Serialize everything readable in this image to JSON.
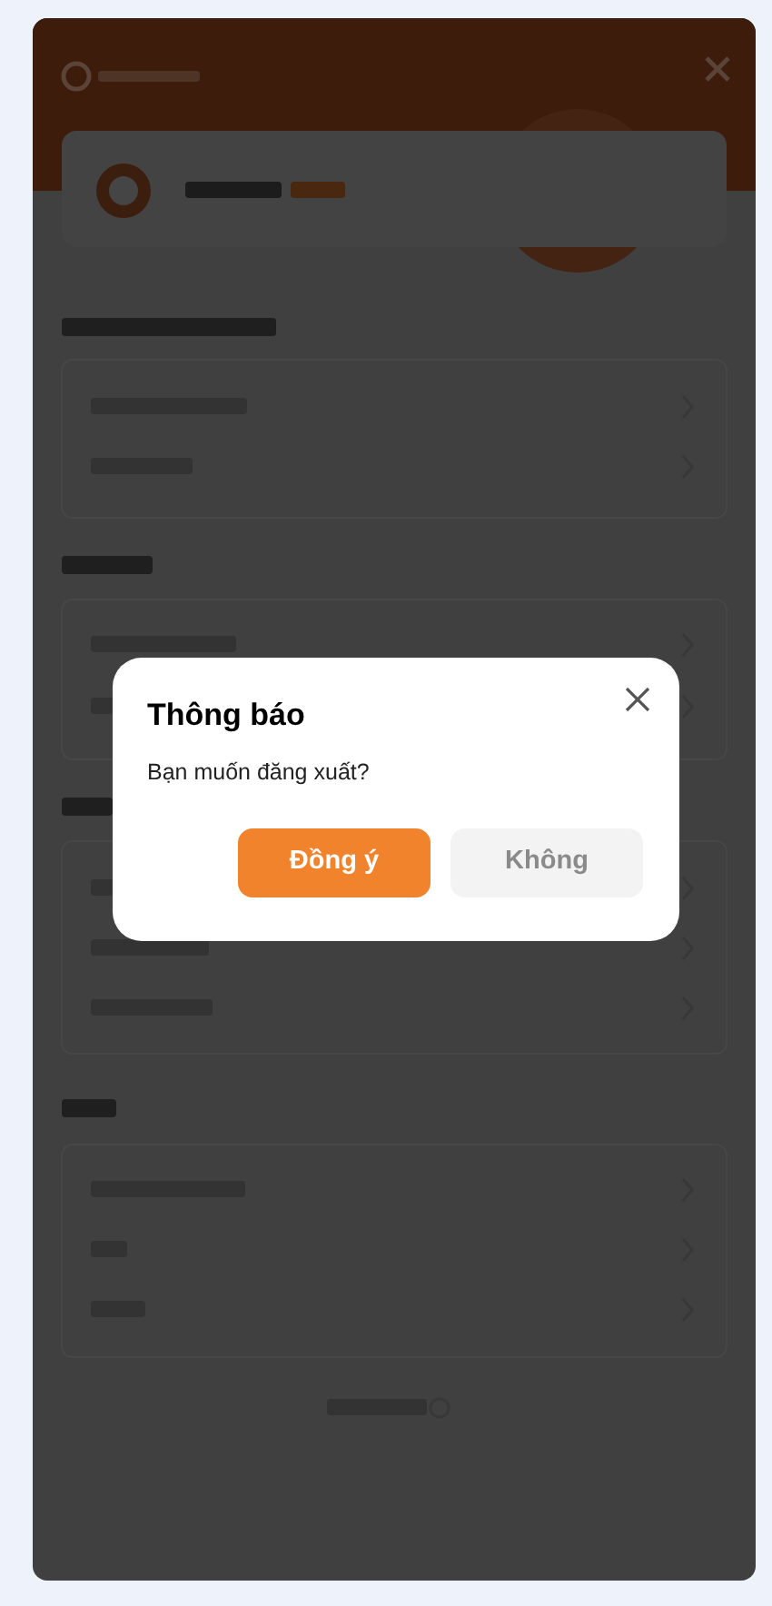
{
  "dialog": {
    "title": "Thông báo",
    "message": "Bạn muốn đăng xuất?",
    "buttons": [
      {
        "label": "Đồng ý",
        "kind": "primary"
      },
      {
        "label": "Không",
        "kind": "secondary"
      }
    ]
  }
}
